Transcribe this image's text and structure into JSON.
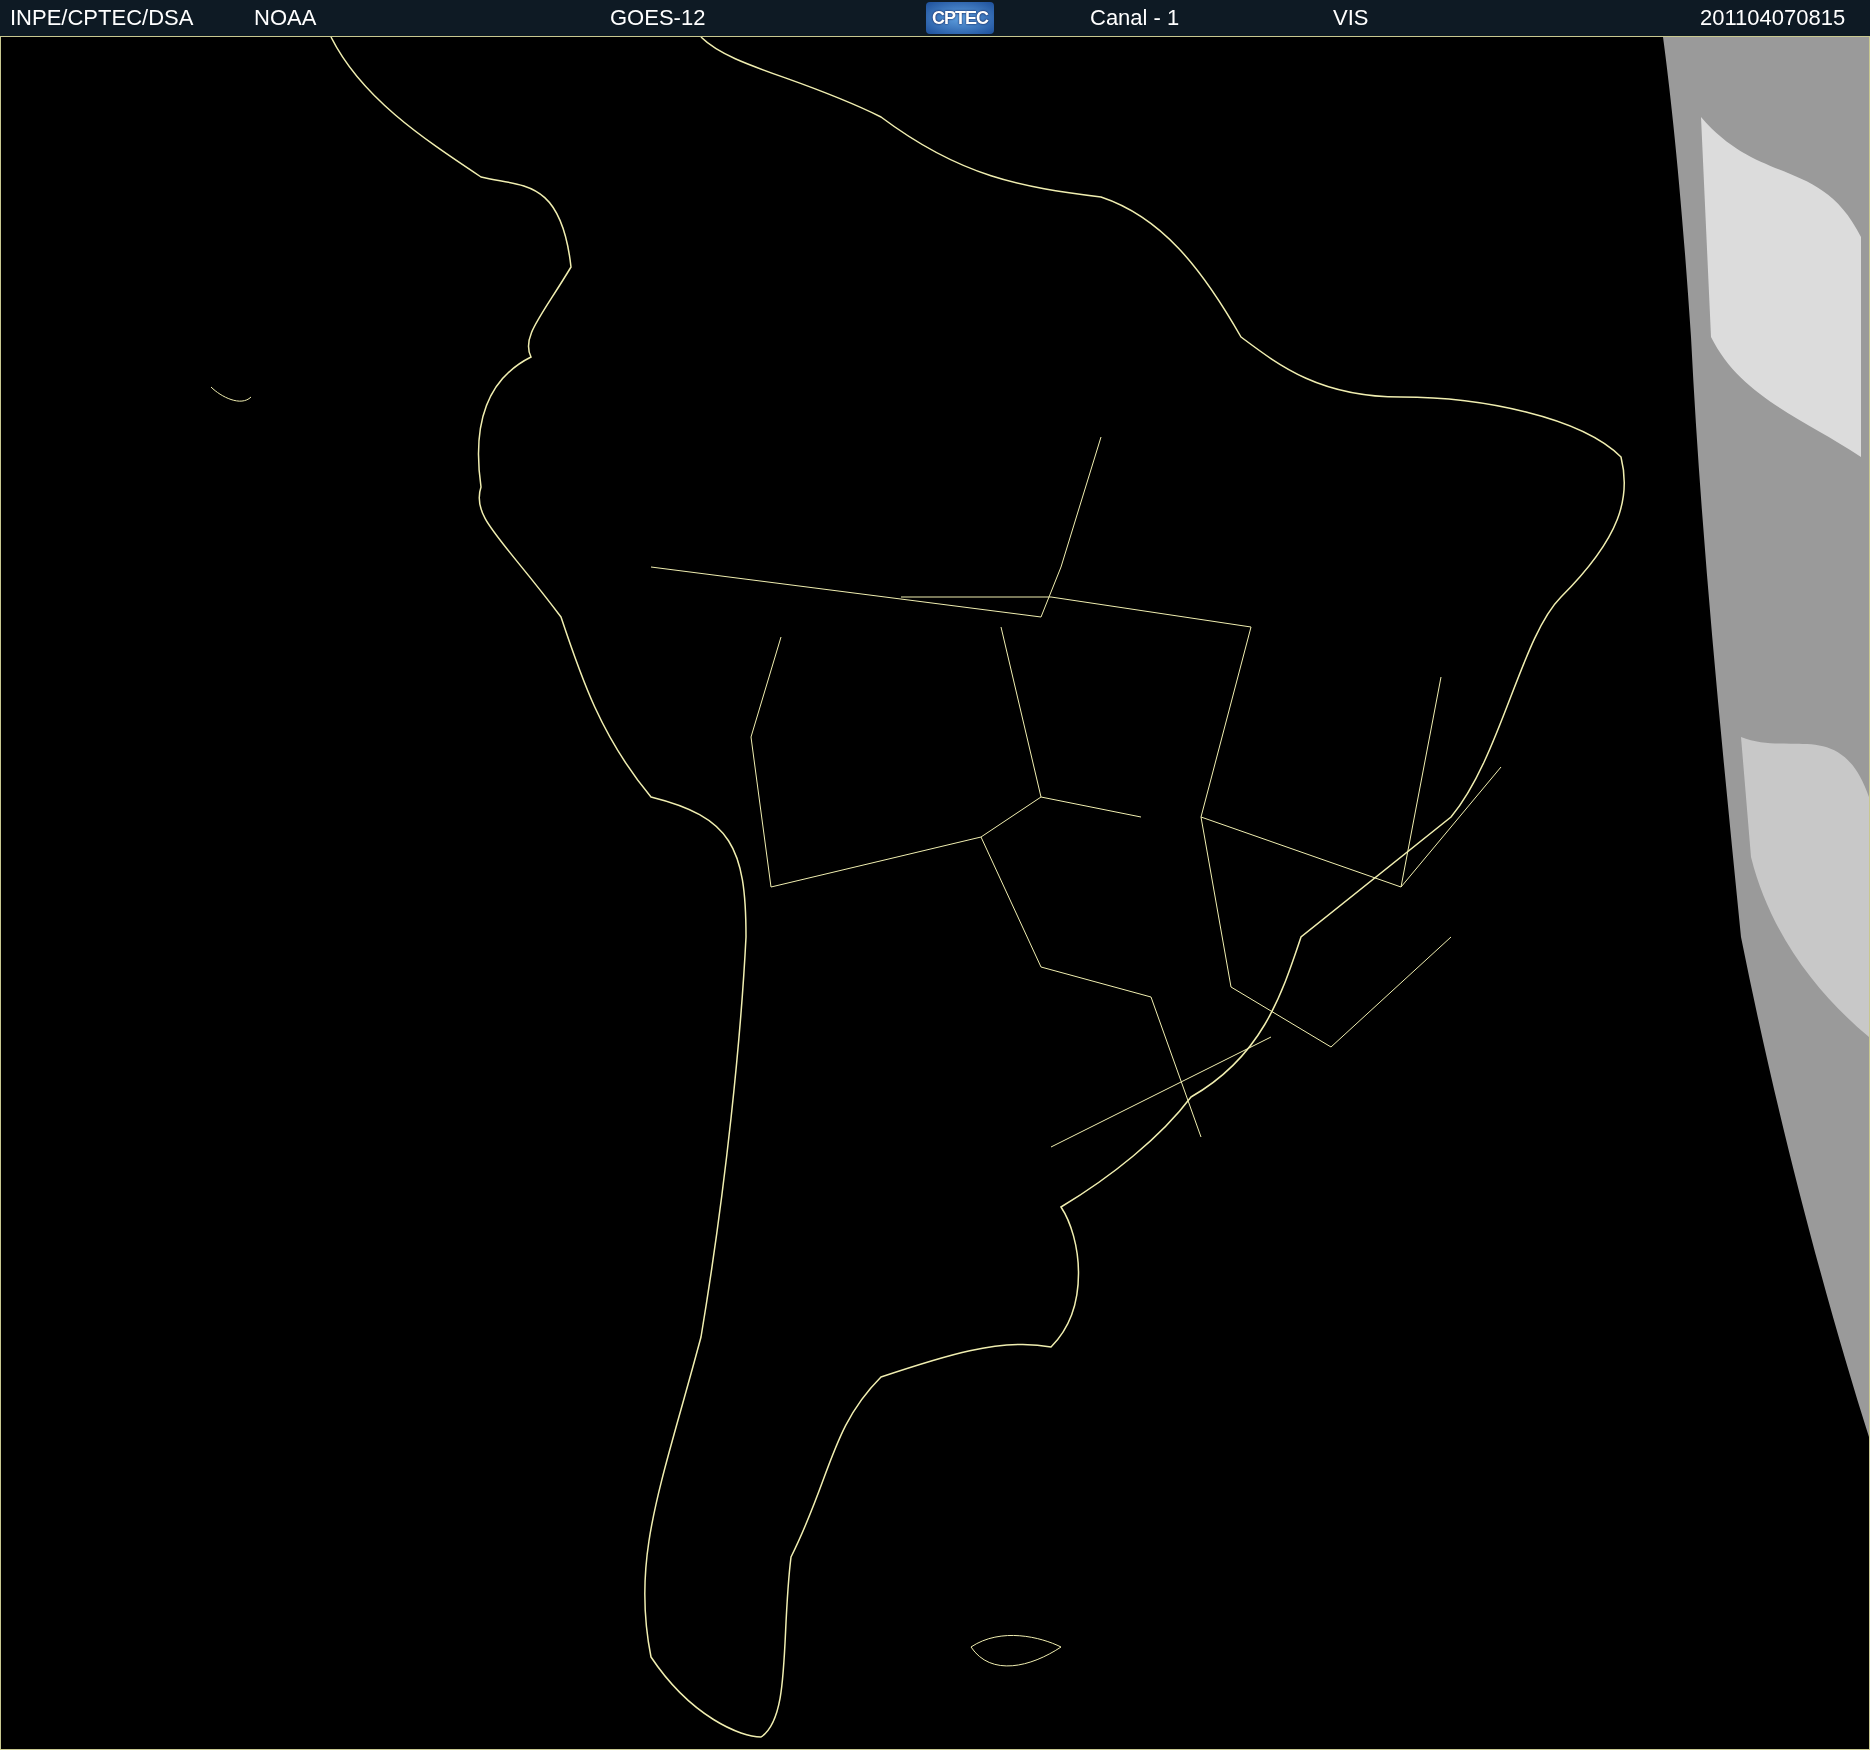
{
  "header": {
    "labels": [
      {
        "text": "INPE/CPTEC/DSA"
      },
      {
        "text": "NOAA"
      },
      {
        "text": "GOES-12"
      },
      {
        "text": "Canal - 1"
      },
      {
        "text": "VIS"
      },
      {
        "text": "201104070815"
      }
    ],
    "logo_text": "CPTEC"
  }
}
